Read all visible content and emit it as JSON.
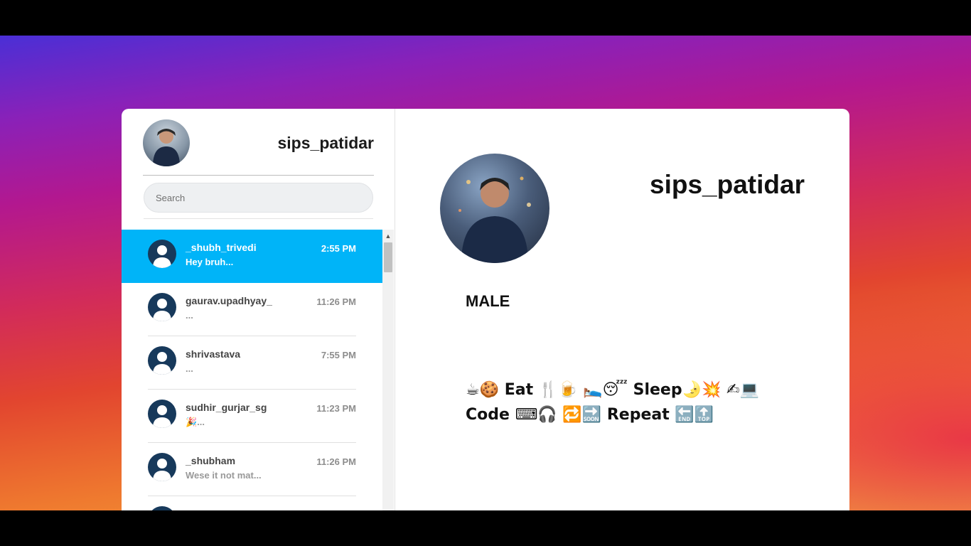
{
  "sidebar": {
    "username": "sips_patidar",
    "search_placeholder": "Search",
    "chats": [
      {
        "name": "_shubh_trivedi",
        "time": "2:55 PM",
        "message": "Hey bruh..."
      },
      {
        "name": "gaurav.upadhyay_",
        "time": "11:26 PM",
        "message": "..."
      },
      {
        "name": "shrivastava",
        "time": "7:55 PM",
        "message": "..."
      },
      {
        "name": "sudhir_gurjar_sg",
        "time": "11:23 PM",
        "message": "🎉..."
      },
      {
        "name": "_shubham",
        "time": "11:26 PM",
        "message": "Wese it not mat..."
      }
    ]
  },
  "profile": {
    "username": "sips_patidar",
    "gender": "MALE",
    "bio": "☕🍪 Eat 🍴🍺 🛌😴 Sleep🌛💥 ✍💻\nCode ⌨🎧 🔁🔜 Repeat 🔚🔝"
  },
  "colors": {
    "active_chat": "#00b4f8",
    "avatar_placeholder": "#17395b"
  }
}
